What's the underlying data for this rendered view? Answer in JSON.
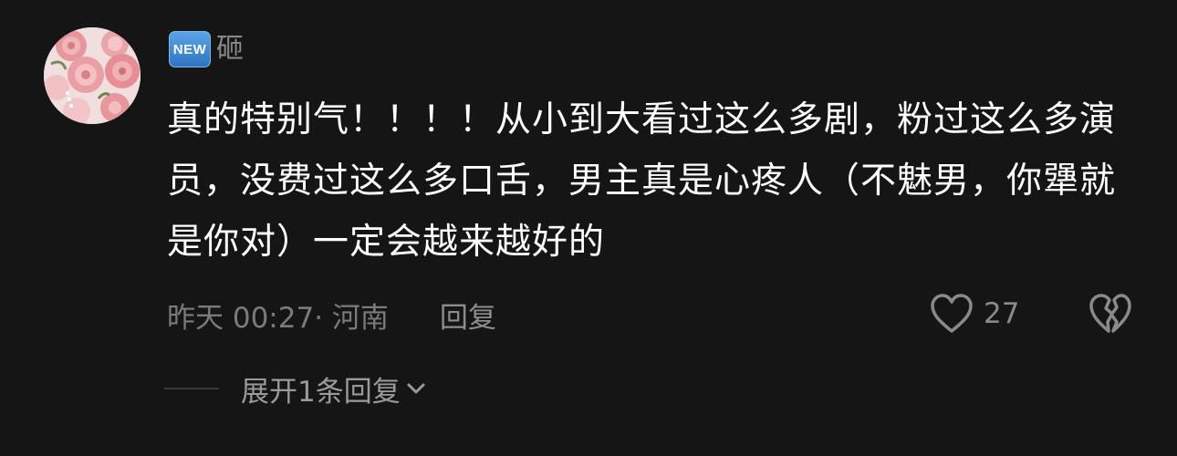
{
  "comment": {
    "avatar_icon": "rose-avatar-icon",
    "badge": "NEW",
    "username": "砸",
    "text": "真的特别气！！！！从小到大看过这么多剧，粉过这么多演员，没费过这么多口舌，男主真是心疼人（不魅男，你犟就是你对）一定会越来越好的",
    "timestamp": "昨天 00:27· 河南",
    "reply_label": "回复",
    "like_icon": "heart-outline-icon",
    "like_count": "27",
    "dislike_icon": "broken-heart-icon",
    "expand_label": "展开1条回复",
    "expand_icon": "chevron-down-icon"
  },
  "colors": {
    "background": "#151515",
    "text_primary": "#ffffff",
    "text_secondary": "#8a8a8a",
    "badge": "#3d86d4"
  }
}
